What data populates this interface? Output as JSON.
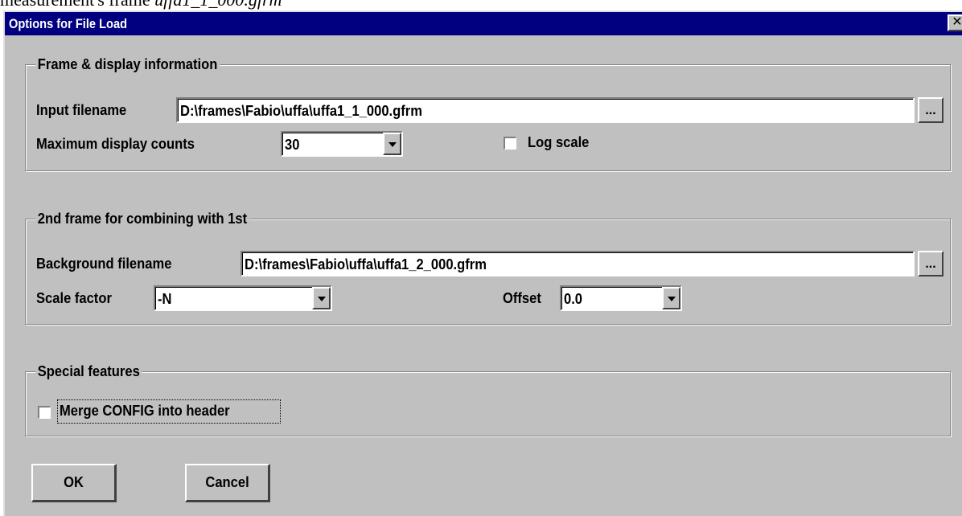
{
  "page_fragment": {
    "prefix": "measurement's frame ",
    "filename": "uffa1_1_000.gfrm"
  },
  "window": {
    "title": "Options for File Load",
    "close_glyph": "✕"
  },
  "frame_group": {
    "legend": "Frame & display information",
    "input_filename_label": "Input filename",
    "input_filename_value": "D:\\frames\\Fabio\\uffa\\uffa1_1_000.gfrm",
    "browse_label": "...",
    "max_counts_label": "Maximum display counts",
    "max_counts_value": "30",
    "log_scale_label": "Log scale",
    "log_scale_checked": false
  },
  "second_group": {
    "legend": "2nd frame for combining with 1st",
    "background_filename_label": "Background filename",
    "background_filename_value": "D:\\frames\\Fabio\\uffa\\uffa1_2_000.gfrm",
    "browse_label": "...",
    "scale_factor_label": "Scale factor",
    "scale_factor_value": "-N",
    "offset_label": "Offset",
    "offset_value": "0.0"
  },
  "special_group": {
    "legend": "Special features",
    "merge_label": "Merge CONFIG into header",
    "merge_checked": false
  },
  "buttons": {
    "ok": "OK",
    "cancel": "Cancel"
  },
  "icons": {
    "dropdown": "chevron-down-icon",
    "close": "close-icon"
  },
  "colors": {
    "titlebar": "#000080",
    "dialog_bg": "#c0c0c0"
  }
}
